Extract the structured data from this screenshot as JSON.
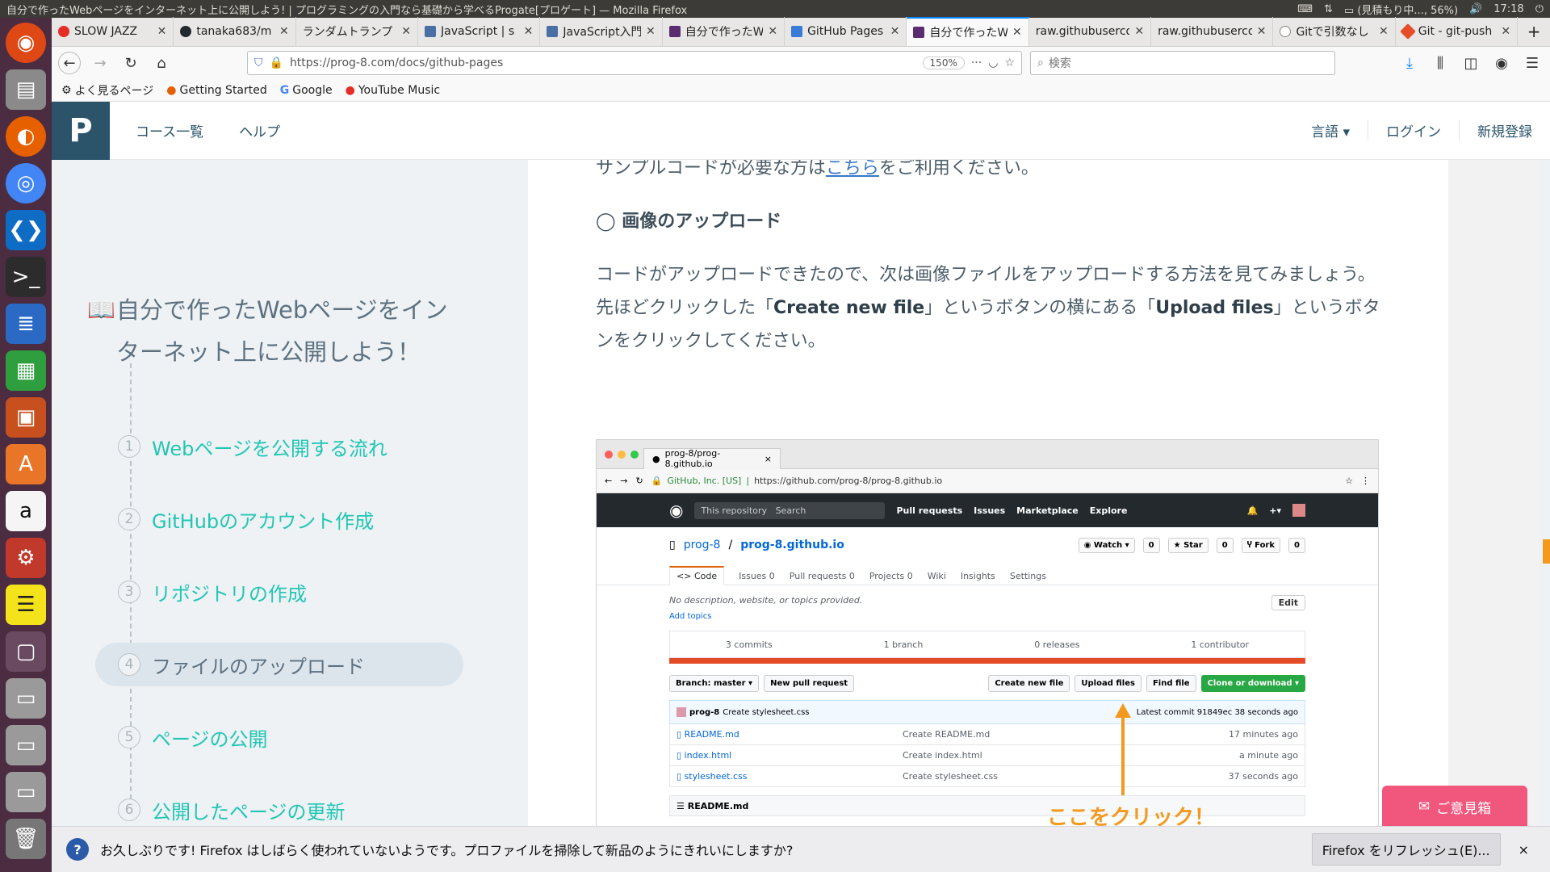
{
  "os_bar": {
    "window_title": "自分で作ったWebページをインターネット上に公開しよう! | プログラミングの入門なら基礎から学べるProgate[プロゲート] — Mozilla Firefox",
    "battery": "(見積もり中..., 56%)",
    "clock": "17:18"
  },
  "launcher": {
    "icons": [
      "ubuntu-icon",
      "files-icon",
      "firefox-icon",
      "chrome-icon",
      "vscode-icon",
      "terminal-icon",
      "writer-icon",
      "calc-icon",
      "impress-icon",
      "software-center-icon",
      "amazon-icon",
      "settings-icon",
      "notes-icon",
      "workspace-icon",
      "drive-icon",
      "drive-icon",
      "drive-icon",
      "trash-icon"
    ]
  },
  "tabs": [
    {
      "label": "SLOW JAZZ",
      "fav_color": "#e52d27",
      "active": false
    },
    {
      "label": "tanaka683/m",
      "fav_color": "#24292e",
      "active": false
    },
    {
      "label": "ランダムトランプ",
      "fav_color": "#cccccc",
      "active": false
    },
    {
      "label": "JavaScript | s",
      "fav_color": "#4a6fa5",
      "active": false
    },
    {
      "label": "JavaScript入門",
      "fav_color": "#4a6fa5",
      "active": false
    },
    {
      "label": "自分で作ったWeb",
      "fav_color": "#5b2c6f",
      "active": false
    },
    {
      "label": "GitHub Pages",
      "fav_color": "#3a7bd5",
      "active": false
    },
    {
      "label": "自分で作ったWeb",
      "fav_color": "#5b2c6f",
      "active": true
    },
    {
      "label": "raw.githubuserco",
      "fav_color": "#e8e7e6",
      "active": false
    },
    {
      "label": "raw.githubuserco",
      "fav_color": "#e8e7e6",
      "active": false
    },
    {
      "label": "Gitで引数なし",
      "fav_color": "#ffffff",
      "active": false
    },
    {
      "label": "Git - git-push",
      "fav_color": "#e44d26",
      "active": false
    }
  ],
  "nav": {
    "url": "https://prog-8.com/docs/github-pages",
    "zoom": "150%",
    "search_placeholder": "検索"
  },
  "bookmarks": {
    "most_visited": "よく見るページ",
    "getting_started": "Getting Started",
    "google": "Google",
    "youtube_music": "YouTube Music"
  },
  "site_header": {
    "logo": "P",
    "courses": "コース一覧",
    "help": "ヘルプ",
    "language": "言語 ▾",
    "login": "ログイン",
    "signup": "新規登録"
  },
  "sidebar": {
    "title": "自分で作ったWebページをインターネット上に公開しよう！",
    "steps": [
      {
        "num": "1",
        "label": "Webページを公開する流れ"
      },
      {
        "num": "2",
        "label": "GitHubのアカウント作成"
      },
      {
        "num": "3",
        "label": "リポジトリの作成"
      },
      {
        "num": "4",
        "label": "ファイルのアップロード"
      },
      {
        "num": "5",
        "label": "ページの公開"
      },
      {
        "num": "6",
        "label": "公開したページの更新"
      }
    ]
  },
  "article": {
    "sample_pre": "サンプルコードが必要な方は",
    "sample_link": "こちら",
    "sample_post": "をご利用ください。",
    "heading": "◯ 画像のアップロード",
    "p1": "コードがアップロードできたので、次は画像ファイルをアップロードする方法を見てみましょう。",
    "p2_pre": "先ほどクリックした「",
    "p2_b1": "Create new file",
    "p2_mid": "」というボタンの横にある「",
    "p2_b2": "Upload files",
    "p2_post": "」というボタンをクリックしてください。",
    "callout": "ここをクリック！"
  },
  "screenshot": {
    "tab_title": "prog-8/prog-8.github.io",
    "cert": "GitHub, Inc. [US]",
    "url": "https://github.com/prog-8/prog-8.github.io",
    "gh_nav": {
      "this_repo": "This repository",
      "search": "Search",
      "pulls": "Pull requests",
      "issues": "Issues",
      "marketplace": "Marketplace",
      "explore": "Explore"
    },
    "owner": "prog-8",
    "repo": "prog-8.github.io",
    "watch": "Watch ▾",
    "watch_n": "0",
    "star": "Star",
    "star_n": "0",
    "fork": "Fork",
    "fork_n": "0",
    "tabs": {
      "code": "Code",
      "issues": "Issues 0",
      "pulls": "Pull requests 0",
      "projects": "Projects 0",
      "wiki": "Wiki",
      "insights": "Insights",
      "settings": "Settings"
    },
    "desc": "No description, website, or topics provided.",
    "edit": "Edit",
    "add_topics": "Add topics",
    "stats": {
      "commits": "3 commits",
      "branch": "1 branch",
      "releases": "0 releases",
      "contributor": "1 contributor"
    },
    "branch_btn": "Branch: master ▾",
    "new_pr": "New pull request",
    "create_new_file": "Create new file",
    "upload_files": "Upload files",
    "find_file": "Find file",
    "clone": "Clone or download ▾",
    "commit_user": "prog-8",
    "commit_msg": "Create stylesheet.css",
    "latest_commit": "Latest commit 91849ec 38 seconds ago",
    "files": [
      {
        "name": "README.md",
        "msg": "Create README.md",
        "time": "17 minutes ago"
      },
      {
        "name": "index.html",
        "msg": "Create index.html",
        "time": "a minute ago"
      },
      {
        "name": "stylesheet.css",
        "msg": "Create stylesheet.css",
        "time": "37 seconds ago"
      }
    ],
    "readme": "README.md"
  },
  "feedback": "ご意見箱",
  "notification": {
    "message": "お久しぶりです! Firefox はしばらく使われていないようです。プロファイルを掃除して新品のようにきれいにしますか?",
    "button": "Firefox をリフレッシュ(E)...",
    "close": "×"
  }
}
